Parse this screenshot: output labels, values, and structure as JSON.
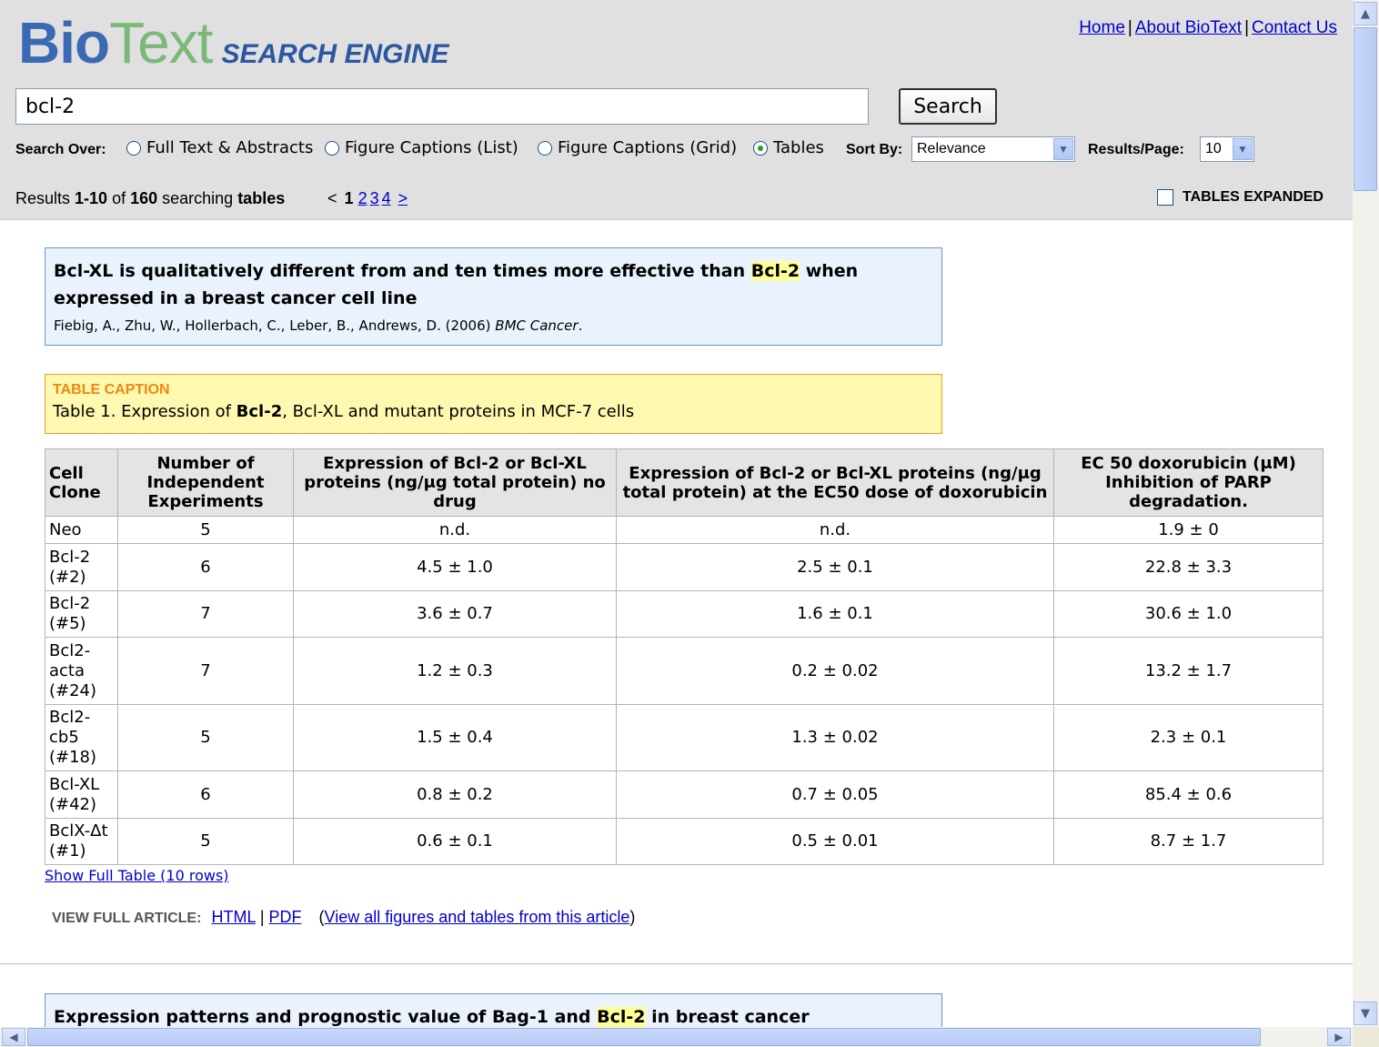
{
  "header": {
    "logo_bio": "Bio",
    "logo_text": "Text",
    "logo_subtitle": "SEARCH ENGINE",
    "links": [
      "Home",
      "About BioText",
      "Contact Us"
    ],
    "sep": "|"
  },
  "search": {
    "value": "bcl-2",
    "button_label": "Search",
    "search_over_label": "Search Over:",
    "options": [
      "Full Text & Abstracts",
      "Figure Captions (List)",
      "Figure Captions (Grid)",
      "Tables"
    ],
    "selected_option": "Tables",
    "sort_label": "Sort By:",
    "sort_value": "Relevance",
    "per_page_label": "Results/Page:",
    "per_page_value": "10"
  },
  "results": {
    "prefix": "Results ",
    "range": "1-10",
    "of": " of ",
    "total": "160",
    "searching": " searching ",
    "what": "tables",
    "pager": {
      "prev": "<",
      "current": "1",
      "pages": [
        "2",
        "3",
        "4"
      ],
      "next": ">"
    },
    "expanded_label": "TABLES EXPANDED"
  },
  "result1": {
    "title_before": "Bcl-XL is qualitatively different from and ten times more effective than ",
    "title_highlight": "Bcl-2",
    "title_after": " when expressed in a breast cancer cell line",
    "authors": "Fiebig, A., Zhu, W., Hollerbach, C., Leber, B., Andrews, D. (2006) ",
    "journal": "BMC Cancer",
    "journal_after": ".",
    "caption_label": "TABLE CAPTION",
    "caption_before": "Table 1. Expression of ",
    "caption_bold": "Bcl-2",
    "caption_after": ", Bcl-XL and mutant proteins in MCF-7 cells",
    "table": {
      "headers": [
        "Cell Clone",
        "Number of Independent Experiments",
        "Expression of Bcl-2 or Bcl-XL proteins (ng/μg total protein) no drug",
        "Expression of Bcl-2 or Bcl-XL proteins (ng/μg total protein) at the EC50 dose of doxorubicin",
        "EC 50 doxorubicin (μM) Inhibition of PARP degradation."
      ],
      "rows": [
        [
          "Neo",
          "5",
          "n.d.",
          "n.d.",
          "1.9 ± 0"
        ],
        [
          "Bcl-2 (#2)",
          "6",
          "4.5 ± 1.0",
          "2.5 ± 0.1",
          "22.8 ± 3.3"
        ],
        [
          "Bcl-2 (#5)",
          "7",
          "3.6 ± 0.7",
          "1.6 ± 0.1",
          "30.6 ± 1.0"
        ],
        [
          "Bcl2-acta (#24)",
          "7",
          "1.2 ± 0.3",
          "0.2 ± 0.02",
          "13.2 ± 1.7"
        ],
        [
          "Bcl2-cb5 (#18)",
          "5",
          "1.5 ± 0.4",
          "1.3 ± 0.02",
          "2.3 ± 0.1"
        ],
        [
          "Bcl-XL (#42)",
          "6",
          "0.8 ± 0.2",
          "0.7 ± 0.05",
          "85.4 ± 0.6"
        ],
        [
          "BclX-Δt (#1)",
          "5",
          "0.6 ± 0.1",
          "0.5 ± 0.01",
          "8.7 ± 1.7"
        ]
      ]
    },
    "show_full": "Show Full Table (10 rows)",
    "view_full_label": "VIEW FULL ARTICLE:",
    "html_link": "HTML",
    "pdf_link": "PDF",
    "paren_open": "(",
    "view_all_link": "View all figures and tables from this article",
    "paren_close": ")"
  },
  "result2": {
    "title_before": "Expression patterns and prognostic value of Bag-1 and ",
    "title_highlight": "Bcl-2",
    "title_after": " in breast cancer"
  }
}
